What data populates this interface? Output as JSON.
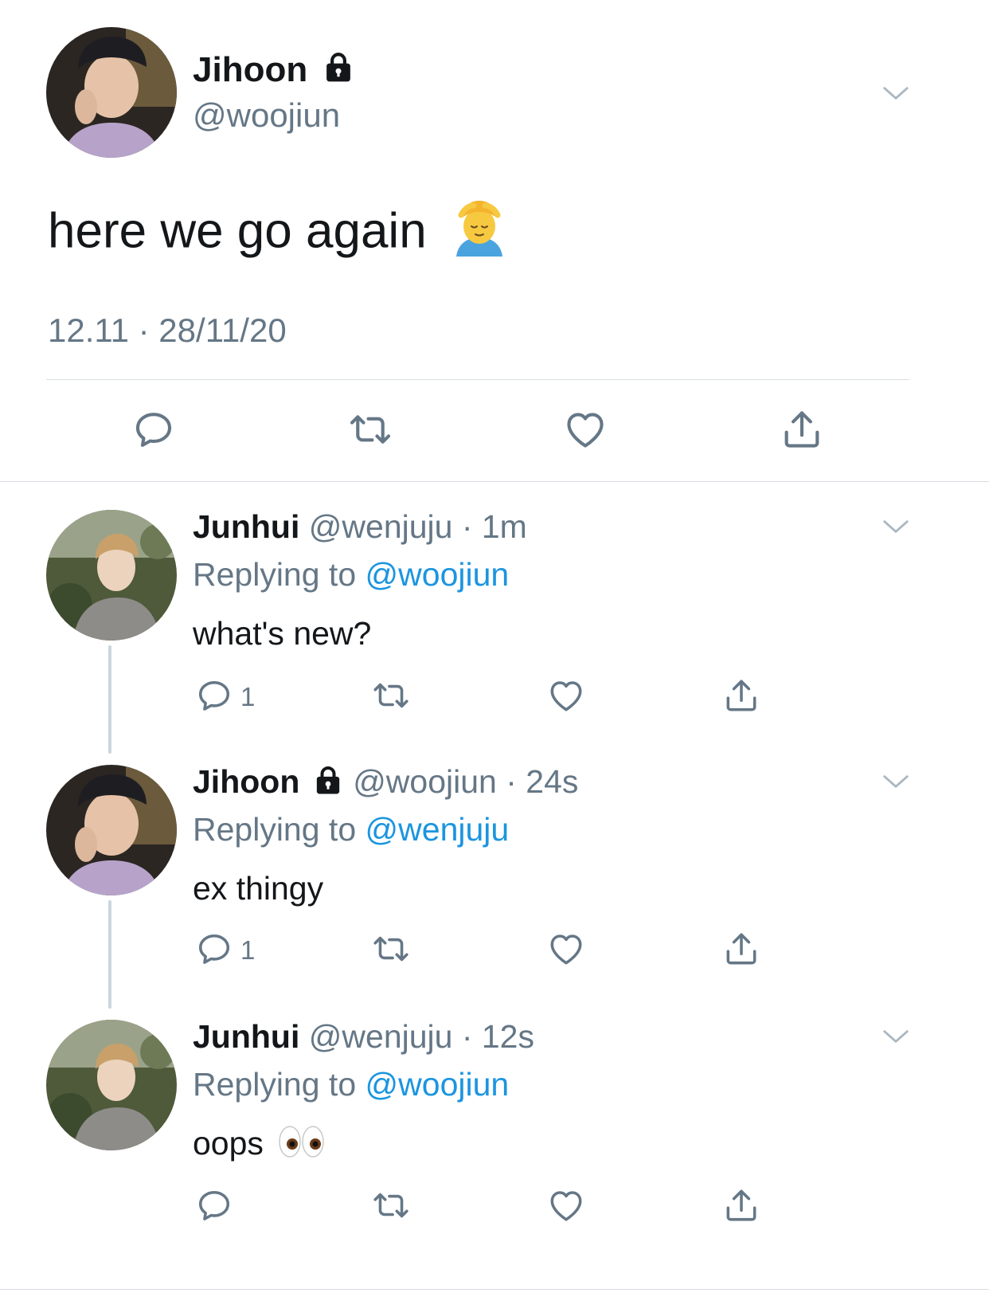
{
  "main_tweet": {
    "name": "Jihoon",
    "handle": "@woojiun",
    "text": "here we go again",
    "meta": "12.11 · 28/11/20"
  },
  "replies": [
    {
      "name": "Junhui",
      "handle": "@wenjuju",
      "time": "1m",
      "replying_label": "Replying to",
      "replying_to": "@woojiun",
      "text": "what's new?",
      "reply_count": "1"
    },
    {
      "name": "Jihoon",
      "handle": "@woojiun",
      "time": "24s",
      "replying_label": "Replying to",
      "replying_to": "@wenjuju",
      "text": "ex thingy",
      "reply_count": "1"
    },
    {
      "name": "Junhui",
      "handle": "@wenjuju",
      "time": "12s",
      "replying_label": "Replying to",
      "replying_to": "@woojiun",
      "text": "oops",
      "reply_count": ""
    }
  ],
  "icons": {
    "reply": "reply-icon",
    "retweet": "retweet-icon",
    "like": "heart-icon",
    "share": "share-icon",
    "more": "chevron-down-icon",
    "protected": "lock-icon",
    "emoji_main": "person-getting-massage-emoji",
    "emoji_oops": "eyes-emoji"
  },
  "colors": {
    "link": "#1b95e0",
    "secondary_text": "#657786",
    "icon": "#657786",
    "divider": "#d8dde2",
    "thread_line": "#ccd6dd"
  }
}
